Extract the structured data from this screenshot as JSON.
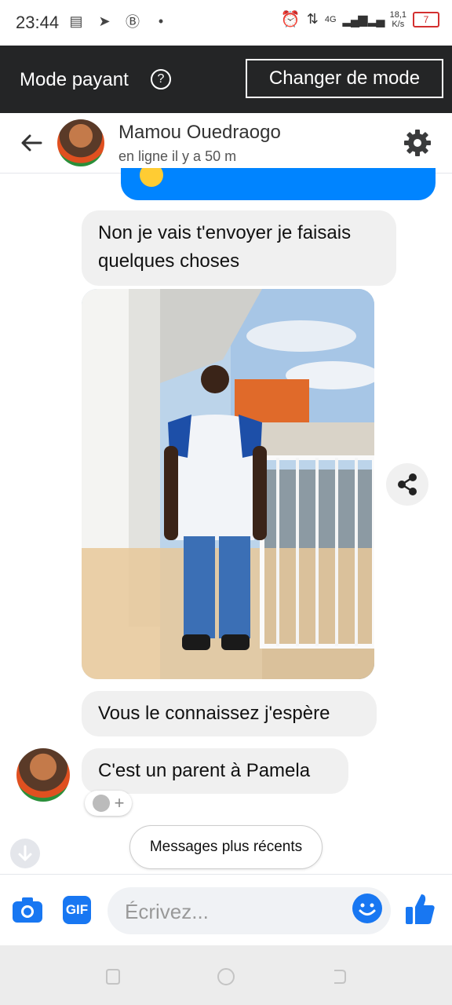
{
  "status_bar": {
    "time": "23:44",
    "network_type": "4G",
    "speed_value": "18,1",
    "speed_unit": "K/s",
    "battery": "7"
  },
  "mode_bar": {
    "label": "Mode payant",
    "help_icon": "?",
    "change_button": "Changer de mode"
  },
  "header": {
    "name": "Mamou Ouedraogo",
    "status": "en ligne il y a 50 m"
  },
  "messages": [
    {
      "text": "Non je vais t'envoyer je faisais quelques choses"
    },
    {
      "text": "Vous le connaissez j'espère"
    },
    {
      "text": "C'est un parent à Pamela"
    }
  ],
  "reaction_add": "+",
  "newer_messages_button": "Messages plus récents",
  "composer": {
    "placeholder": "Écrivez...",
    "gif_label": "GIF"
  },
  "colors": {
    "accent": "#1877f2",
    "sent_bubble": "#0084ff",
    "mode_bar": "#242526"
  }
}
